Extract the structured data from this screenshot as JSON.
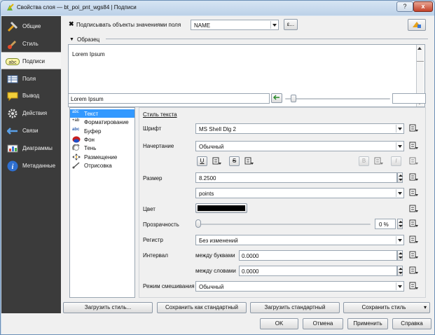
{
  "window": {
    "title": "Свойства слоя — bt_poi_pnt_wgs84 | Подписи",
    "help_label": "?",
    "close_label": "x"
  },
  "sidebar": {
    "items": [
      {
        "label": "Общие"
      },
      {
        "label": "Стиль"
      },
      {
        "label": "Подписи"
      },
      {
        "label": "Поля"
      },
      {
        "label": "Вывод"
      },
      {
        "label": "Действия"
      },
      {
        "label": "Связи"
      },
      {
        "label": "Диаграммы"
      },
      {
        "label": "Метаданные"
      }
    ]
  },
  "top": {
    "label_checkbox": "Подписывать объекты значениями поля",
    "field_value": "NAME",
    "expr_button": "ε..."
  },
  "preview": {
    "section_title": "Образец",
    "text": "Lorem Ipsum",
    "input_value": "Lorem Ipsum"
  },
  "categories": [
    {
      "icon_text": "abc",
      "label": "Текст"
    },
    {
      "icon_text": "+ab",
      "label": "Форматирование"
    },
    {
      "icon_text": "abc",
      "label": "Буфер"
    },
    {
      "icon_text": "",
      "label": "Фон"
    },
    {
      "icon_text": "",
      "label": "Тень"
    },
    {
      "icon_text": "",
      "label": "Размещение"
    },
    {
      "icon_text": "",
      "label": "Отрисовка"
    }
  ],
  "text_style": {
    "heading": "Стиль текста",
    "font_label": "Шрифт",
    "font_value": "MS Shell Dlg 2",
    "style_label": "Начертание",
    "style_value": "Обычный",
    "underline": "U",
    "strike": "S",
    "bold": "B",
    "italic": "I",
    "size_label": "Размер",
    "size_value": "8.2500",
    "units_value": "points",
    "color_label": "Цвет",
    "color_hex": "#000000",
    "transparency_label": "Прозрачность",
    "transparency_value": "0 %",
    "case_label": "Регистр",
    "case_value": "Без изменений",
    "spacing_label": "Интервал",
    "letter_label": "между буквами",
    "letter_value": "0.0000",
    "word_label": "между словами",
    "word_value": "0.0000",
    "blend_label": "Режим смешивания",
    "blend_value": "Обычный"
  },
  "bottom": {
    "load_style": "Загрузить стиль...",
    "save_default": "Сохранить как стандартный",
    "load_default": "Загрузить стандартный",
    "save_style": "Сохранить стиль",
    "ok": "OK",
    "cancel": "Отмена",
    "apply": "Применить",
    "help": "Справка"
  }
}
